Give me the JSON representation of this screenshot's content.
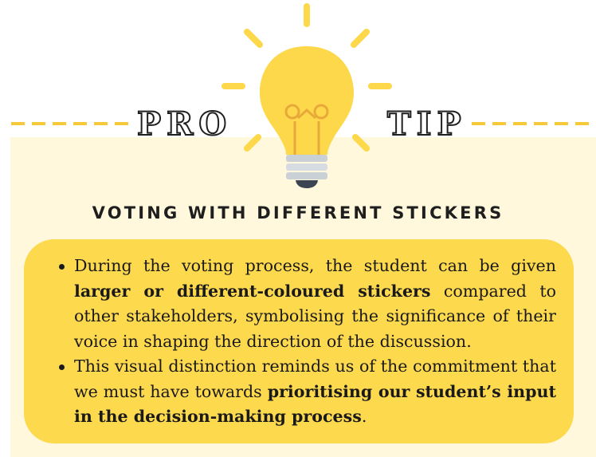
{
  "header": {
    "left_word": "PRO",
    "right_word": "TIP"
  },
  "subtitle": "VOTING WITH DIFFERENT STICKERS",
  "bullets": [
    {
      "pre": "During the voting process, the student can be given ",
      "bold": "larger or different-coloured stickers",
      "post": " compared to other stakeholders, symbolising the significance of their voice in shaping the direction of the discussion."
    },
    {
      "pre": "This visual distinction reminds us of the commitment that we must have towards ",
      "bold": "prioritising our student’s input in the decision-making process",
      "post": "."
    }
  ],
  "colors": {
    "accent_yellow": "#fdd94e",
    "panel_cream": "#fff8dc",
    "dash_yellow": "#f5c93a",
    "bulb_yellow": "#fcd84a",
    "bulb_base_gray": "#c9d0d6",
    "text_dark": "#1a1a1a"
  },
  "icons": [
    "lightbulb-icon"
  ]
}
